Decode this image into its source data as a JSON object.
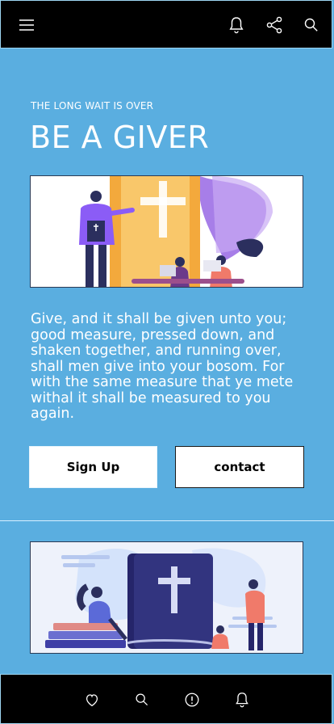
{
  "header": {
    "icons": [
      "menu-icon",
      "bell-icon",
      "share-icon",
      "search-icon"
    ]
  },
  "hero": {
    "eyebrow": "THE LONG WAIT IS OVER",
    "title": "BE A GIVER",
    "quote": "Give, and it shall be given unto you; good measure, pressed down, and shaken together, and running over, shall men give into your bosom. For with the same measure that ye mete withal it shall be measured to you again.",
    "signup_label": "Sign Up",
    "contact_label": "contact"
  },
  "bottom_nav": {
    "icons": [
      "heart-icon",
      "search-icon",
      "info-icon",
      "bell-icon"
    ]
  },
  "colors": {
    "background": "#5aaee0",
    "bar": "#000000",
    "text": "#ffffff",
    "accent_orange": "#f5b547",
    "accent_purple": "#8b5cf6",
    "book_navy": "#25256a"
  }
}
